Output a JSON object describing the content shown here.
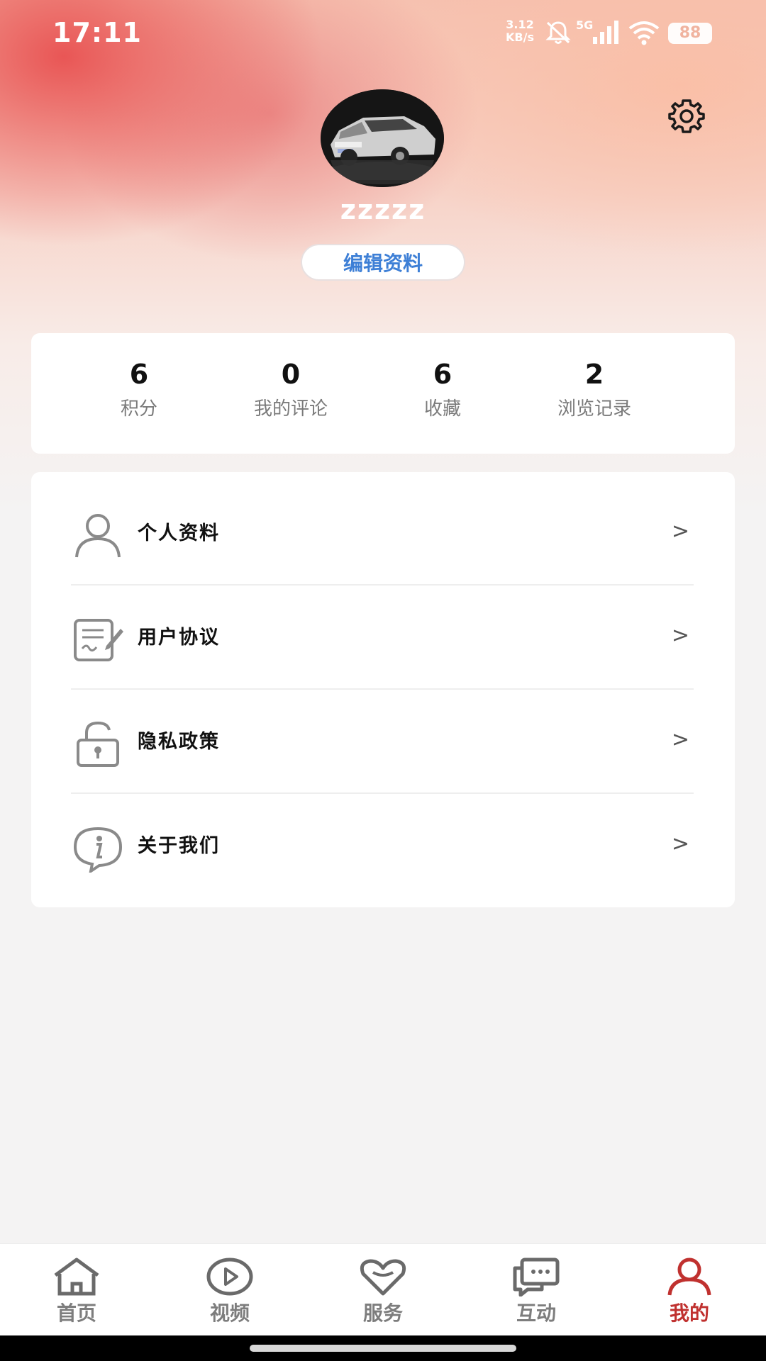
{
  "status_bar": {
    "time": "17:11",
    "net_speed_value": "3.12",
    "net_speed_unit": "KB/s",
    "network_type": "5G",
    "battery": "88"
  },
  "profile": {
    "username": "zzzzz",
    "edit_button_label": "编辑资料",
    "avatar_icon": "car-photo-avatar",
    "settings_icon": "gear-icon"
  },
  "stats": [
    {
      "value": "6",
      "label": "积分"
    },
    {
      "value": "0",
      "label": "我的评论"
    },
    {
      "value": "6",
      "label": "收藏"
    },
    {
      "value": "2",
      "label": "浏览记录"
    }
  ],
  "menu": [
    {
      "label": "个人资料",
      "icon": "person-icon",
      "chevron": ">"
    },
    {
      "label": "用户协议",
      "icon": "agreement-icon",
      "chevron": ">"
    },
    {
      "label": "隐私政策",
      "icon": "lock-icon",
      "chevron": ">"
    },
    {
      "label": "关于我们",
      "icon": "info-icon",
      "chevron": ">"
    }
  ],
  "tabs": [
    {
      "label": "首页",
      "icon": "home-icon",
      "active": false
    },
    {
      "label": "视频",
      "icon": "play-icon",
      "active": false
    },
    {
      "label": "服务",
      "icon": "heart-icon",
      "active": false
    },
    {
      "label": "互动",
      "icon": "chat-icon",
      "active": false
    },
    {
      "label": "我的",
      "icon": "profile-icon",
      "active": true
    }
  ],
  "colors": {
    "accent_active": "#c0312f",
    "edit_button_text": "#3d7fd6",
    "tab_inactive": "#7d7d7d"
  }
}
